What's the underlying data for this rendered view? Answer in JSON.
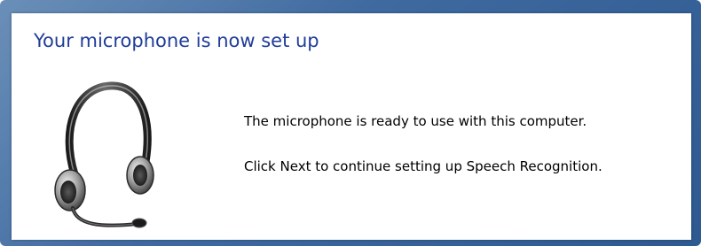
{
  "dialog": {
    "title": "Your microphone is now set up",
    "message_ready": "The microphone is ready to use with this computer.",
    "message_next": "Click Next to continue setting up Speech Recognition.",
    "illustration_icon": "headset-icon"
  },
  "colors": {
    "title": "#1f3c99",
    "frame": "#3f6aa0",
    "panel_background": "#ffffff"
  }
}
